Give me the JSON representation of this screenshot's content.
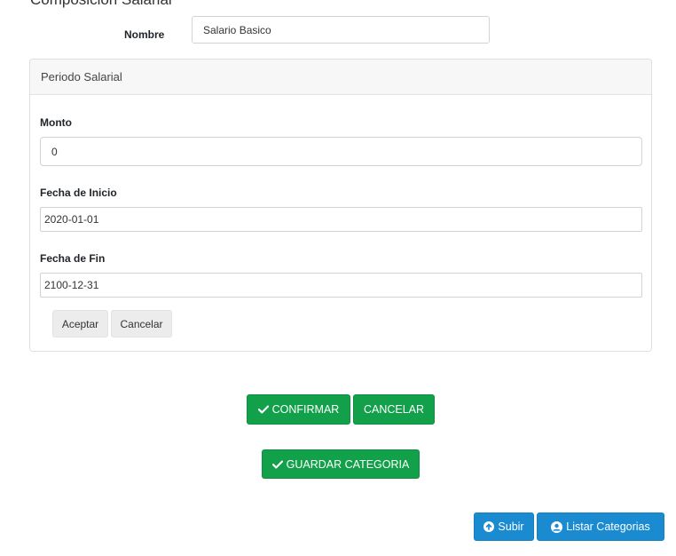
{
  "form": {
    "section_title": "Composicion Salarial",
    "name_label": "Nombre",
    "name_value": "Salario Basico"
  },
  "periodo": {
    "header": "Periodo Salarial",
    "monto_label": "Monto",
    "monto_value": "0",
    "fecha_inicio_label": "Fecha de Inicio",
    "fecha_inicio_value": "2020-01-01",
    "fecha_fin_label": "Fecha de Fin",
    "fecha_fin_value": "2100-12-31",
    "aceptar_label": "Aceptar",
    "cancelar_label": "Cancelar"
  },
  "actions": {
    "confirmar_label": "CONFIRMAR",
    "cancelar_label": "CANCELAR",
    "guardar_label": "GUARDAR CATEGORIA",
    "subir_label": "Subir",
    "listar_label": "Listar Categorias"
  },
  "icons": {
    "confirm": "check-icon",
    "save": "check-icon",
    "upload": "arrow-circle-up-icon",
    "list": "user-circle-icon"
  },
  "colors": {
    "success": "#12a04a",
    "primary": "#1a8bd0"
  }
}
